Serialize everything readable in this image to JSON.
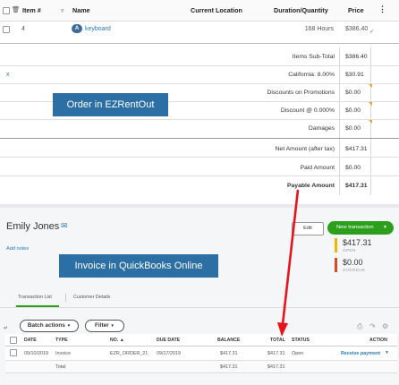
{
  "ezrentout": {
    "columns": {
      "item_no": "Item #",
      "name": "Name",
      "location": "Current Location",
      "duration": "Duration/Quantity",
      "price": "Price"
    },
    "row": {
      "item_no": "4",
      "badge": "A",
      "name": "keyboard",
      "duration": "168 Hours",
      "price": "$386.40"
    },
    "x_mark": "x",
    "totals": [
      {
        "label": "Items Sub-Total",
        "value": "$386.40"
      },
      {
        "label": "California: 8.00%",
        "value": "$30.91"
      },
      {
        "label": "Discounts on Promotions",
        "value": "$0.00"
      },
      {
        "label": "Discount @ 0.000%",
        "value": "$0.00"
      },
      {
        "label": "Damages",
        "value": "$0.00"
      },
      {
        "label": "Net Amount (after tax)",
        "value": "$417.31"
      },
      {
        "label": "Paid Amount",
        "value": "$0.00"
      },
      {
        "label": "Payable Amount",
        "value": "$417.31"
      }
    ],
    "callout": "Order in EZRentOut"
  },
  "quickbooks": {
    "customer_name": "Emily Jones",
    "add_notes": "Add notes",
    "edit_label": "Edit",
    "new_transaction_label": "New transaction",
    "open_amount": "$417.31",
    "open_label": "OPEN",
    "overdue_amount": "$0.00",
    "overdue_label": "OVERDUE",
    "callout": "Invoice in QuickBooks Online",
    "tabs": [
      "Transaction List",
      "Customer Details"
    ],
    "batch_actions_label": "Batch actions",
    "filter_label": "Filter",
    "table_headers": {
      "date": "DATE",
      "type": "TYPE",
      "no": "NO.",
      "due_date": "DUE DATE",
      "balance": "BALANCE",
      "total": "TOTAL",
      "status": "STATUS",
      "action": "ACTION"
    },
    "row": {
      "date": "09/10/2019",
      "type": "Invoice",
      "no": "EZR_ORDER_21",
      "due_date": "09/17/2019",
      "balance": "$417.31",
      "total": "$417.31",
      "status": "Open",
      "action": "Receive payment"
    },
    "total_row": {
      "label": "Total",
      "balance": "$417.31",
      "total": "$417.31"
    },
    "colors": {
      "green": "#2ca01c",
      "open_bar": "#f3b400",
      "overdue_bar": "#d54c22",
      "arrow": "#e8141c",
      "callout": "#2c6fa4"
    }
  }
}
